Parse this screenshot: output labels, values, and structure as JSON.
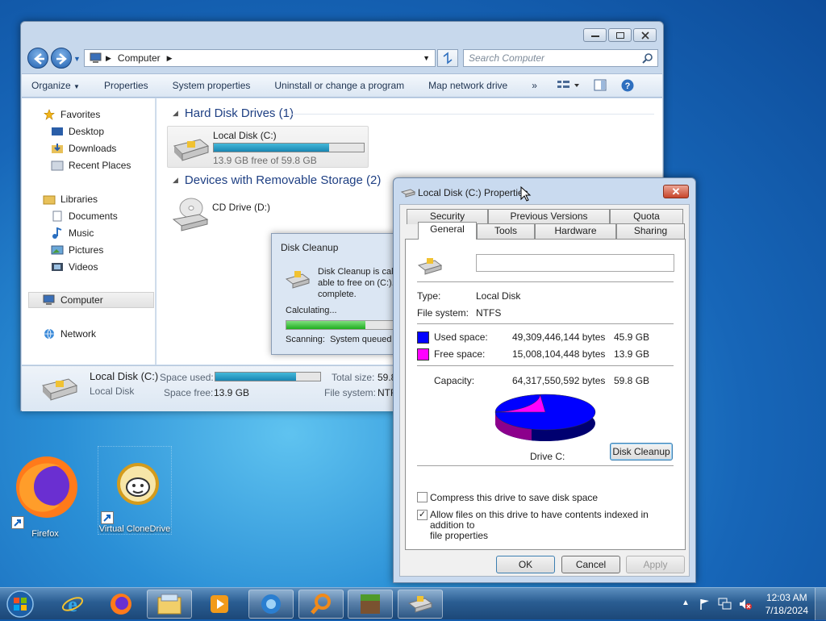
{
  "desktop": {
    "icons": [
      {
        "label": "Firefox",
        "icon": "firefox-icon"
      },
      {
        "label": "Virtual CloneDrive",
        "icon": "sheep-icon"
      }
    ]
  },
  "explorer": {
    "address": "Computer",
    "search_placeholder": "Search Computer",
    "toolbar": {
      "organize": "Organize",
      "properties": "Properties",
      "system_properties": "System properties",
      "uninstall": "Uninstall or change a program",
      "map_drive": "Map network drive",
      "more": "»"
    },
    "nav": {
      "favorites": "Favorites",
      "desktop": "Desktop",
      "downloads": "Downloads",
      "recent": "Recent Places",
      "libraries": "Libraries",
      "documents": "Documents",
      "music": "Music",
      "pictures": "Pictures",
      "videos": "Videos",
      "computer": "Computer",
      "network": "Network"
    },
    "groups": {
      "hdd_title": "Hard Disk Drives (1)",
      "removable_title": "Devices with Removable Storage (2)"
    },
    "drive_c": {
      "name": "Local Disk (C:)",
      "free_text": "13.9 GB free of 59.8 GB",
      "used_fraction": 0.77
    },
    "drive_d": {
      "name": "CD Drive (D:)"
    },
    "details": {
      "name": "Local Disk (C:)",
      "type": "Local Disk",
      "space_used_label": "Space used:",
      "space_free_label": "Space free:",
      "space_free": "13.9 GB",
      "total_size_label": "Total size:",
      "total_size": "59.8",
      "file_system_label": "File system:",
      "file_system": "NTF"
    }
  },
  "cleanup": {
    "title": "Disk Cleanup",
    "message_l1": "Disk Cleanup is calc",
    "message_l2": "able to free on  (C:).",
    "message_l3": "complete.",
    "calculating": "Calculating...",
    "progress_fraction": 0.7,
    "scanning_label": "Scanning:",
    "scanning_value": "System queued"
  },
  "props": {
    "title": "Local Disk (C:) Properties",
    "tabs_row1": [
      "Security",
      "Previous Versions",
      "Quota"
    ],
    "tabs_row2": [
      "General",
      "Tools",
      "Hardware",
      "Sharing"
    ],
    "label_value": "",
    "type_label": "Type:",
    "type_value": "Local Disk",
    "fs_label": "File system:",
    "fs_value": "NTFS",
    "used_label": "Used space:",
    "used_bytes": "49,309,446,144 bytes",
    "used_gb": "45.9 GB",
    "free_label": "Free space:",
    "free_bytes": "15,008,104,448 bytes",
    "free_gb": "13.9 GB",
    "capacity_label": "Capacity:",
    "capacity_bytes": "64,317,550,592 bytes",
    "capacity_gb": "59.8 GB",
    "used_color": "#0000ff",
    "free_color": "#ff00ff",
    "drive_label": "Drive C:",
    "disk_cleanup_button": "Disk Cleanup",
    "compress_label": "Compress this drive to save disk space",
    "index_label_l1": "Allow files on this drive to have contents indexed in addition to",
    "index_label_l2": "file properties",
    "ok": "OK",
    "cancel": "Cancel",
    "apply": "Apply"
  },
  "taskbar": {
    "apps": [
      "start-orb",
      "ie-icon",
      "firefox-icon",
      "explorer-icon",
      "media-player-icon",
      "browser-icon",
      "search-icon",
      "minecraft-icon",
      "drive-icon"
    ],
    "time": "12:03 AM",
    "date": "7/18/2024"
  }
}
